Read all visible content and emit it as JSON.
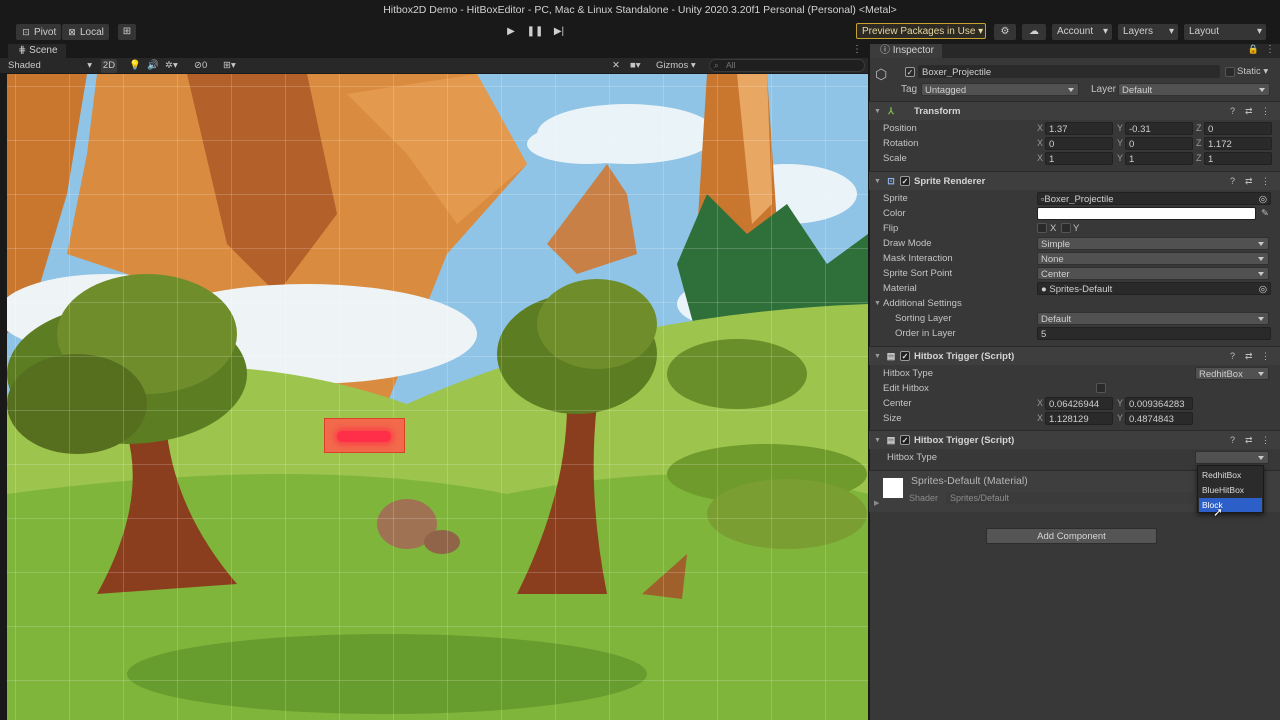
{
  "window": {
    "title": "Hitbox2D Demo - HitBoxEditor - PC, Mac & Linux Standalone - Unity 2020.3.20f1 Personal (Personal) <Metal>"
  },
  "toolbar": {
    "pivot": "Pivot",
    "local": "Local",
    "preview_packages": "Preview Packages in Use",
    "account": "Account",
    "layers": "Layers",
    "layout": "Layout"
  },
  "scene": {
    "tab": "Scene",
    "shading": "Shaded",
    "mode_2d": "2D",
    "hidden_count": "0",
    "gizmos": "Gizmos",
    "search_placeholder": "All"
  },
  "inspector": {
    "tab": "Inspector",
    "object_name": "Boxer_Projectile",
    "static_label": "Static",
    "tag_label": "Tag",
    "tag_value": "Untagged",
    "layer_label": "Layer",
    "layer_value": "Default",
    "transform": {
      "title": "Transform",
      "position": {
        "label": "Position",
        "x": "1.37",
        "y": "-0.31",
        "z": "0"
      },
      "rotation": {
        "label": "Rotation",
        "x": "0",
        "y": "0",
        "z": "1.172"
      },
      "scale": {
        "label": "Scale",
        "x": "1",
        "y": "1",
        "z": "1"
      }
    },
    "axis": {
      "x": "X",
      "y": "Y",
      "z": "Z"
    },
    "sprite_renderer": {
      "title": "Sprite Renderer",
      "sprite_label": "Sprite",
      "sprite_value": "Boxer_Projectile",
      "color_label": "Color",
      "color_value": "#ffffff",
      "flip_label": "Flip",
      "flip_x": "X",
      "flip_y": "Y",
      "draw_mode_label": "Draw Mode",
      "draw_mode_value": "Simple",
      "mask_label": "Mask Interaction",
      "mask_value": "None",
      "sort_point_label": "Sprite Sort Point",
      "sort_point_value": "Center",
      "material_label": "Material",
      "material_value": "Sprites-Default",
      "additional_label": "Additional Settings",
      "sorting_layer_label": "Sorting Layer",
      "sorting_layer_value": "Default",
      "order_label": "Order in Layer",
      "order_value": "5"
    },
    "hitbox1": {
      "title": "Hitbox Trigger (Script)",
      "type_label": "Hitbox Type",
      "type_value": "RedhitBox",
      "edit_label": "Edit Hitbox",
      "center_label": "Center",
      "center_x": "0.06426944",
      "center_y": "0.009364283",
      "size_label": "Size",
      "size_x": "1.128129",
      "size_y": "0.4874843"
    },
    "hitbox2": {
      "title": "Hitbox Trigger (Script)",
      "type_label": "Hitbox Type",
      "options": [
        "RedhitBox",
        "BlueHitBox",
        "Block"
      ],
      "selected_index": 2
    },
    "material": {
      "title": "Sprites-Default (Material)",
      "shader_label": "Shader",
      "shader_value": "Sprites/Default"
    },
    "add_component": "Add Component"
  },
  "colors": {
    "accent": "#2d5fc8",
    "hitbox_fill": "#f26a4b",
    "hitbox_core": "#ff2f4a",
    "transform_icon": "#7cc04a"
  }
}
